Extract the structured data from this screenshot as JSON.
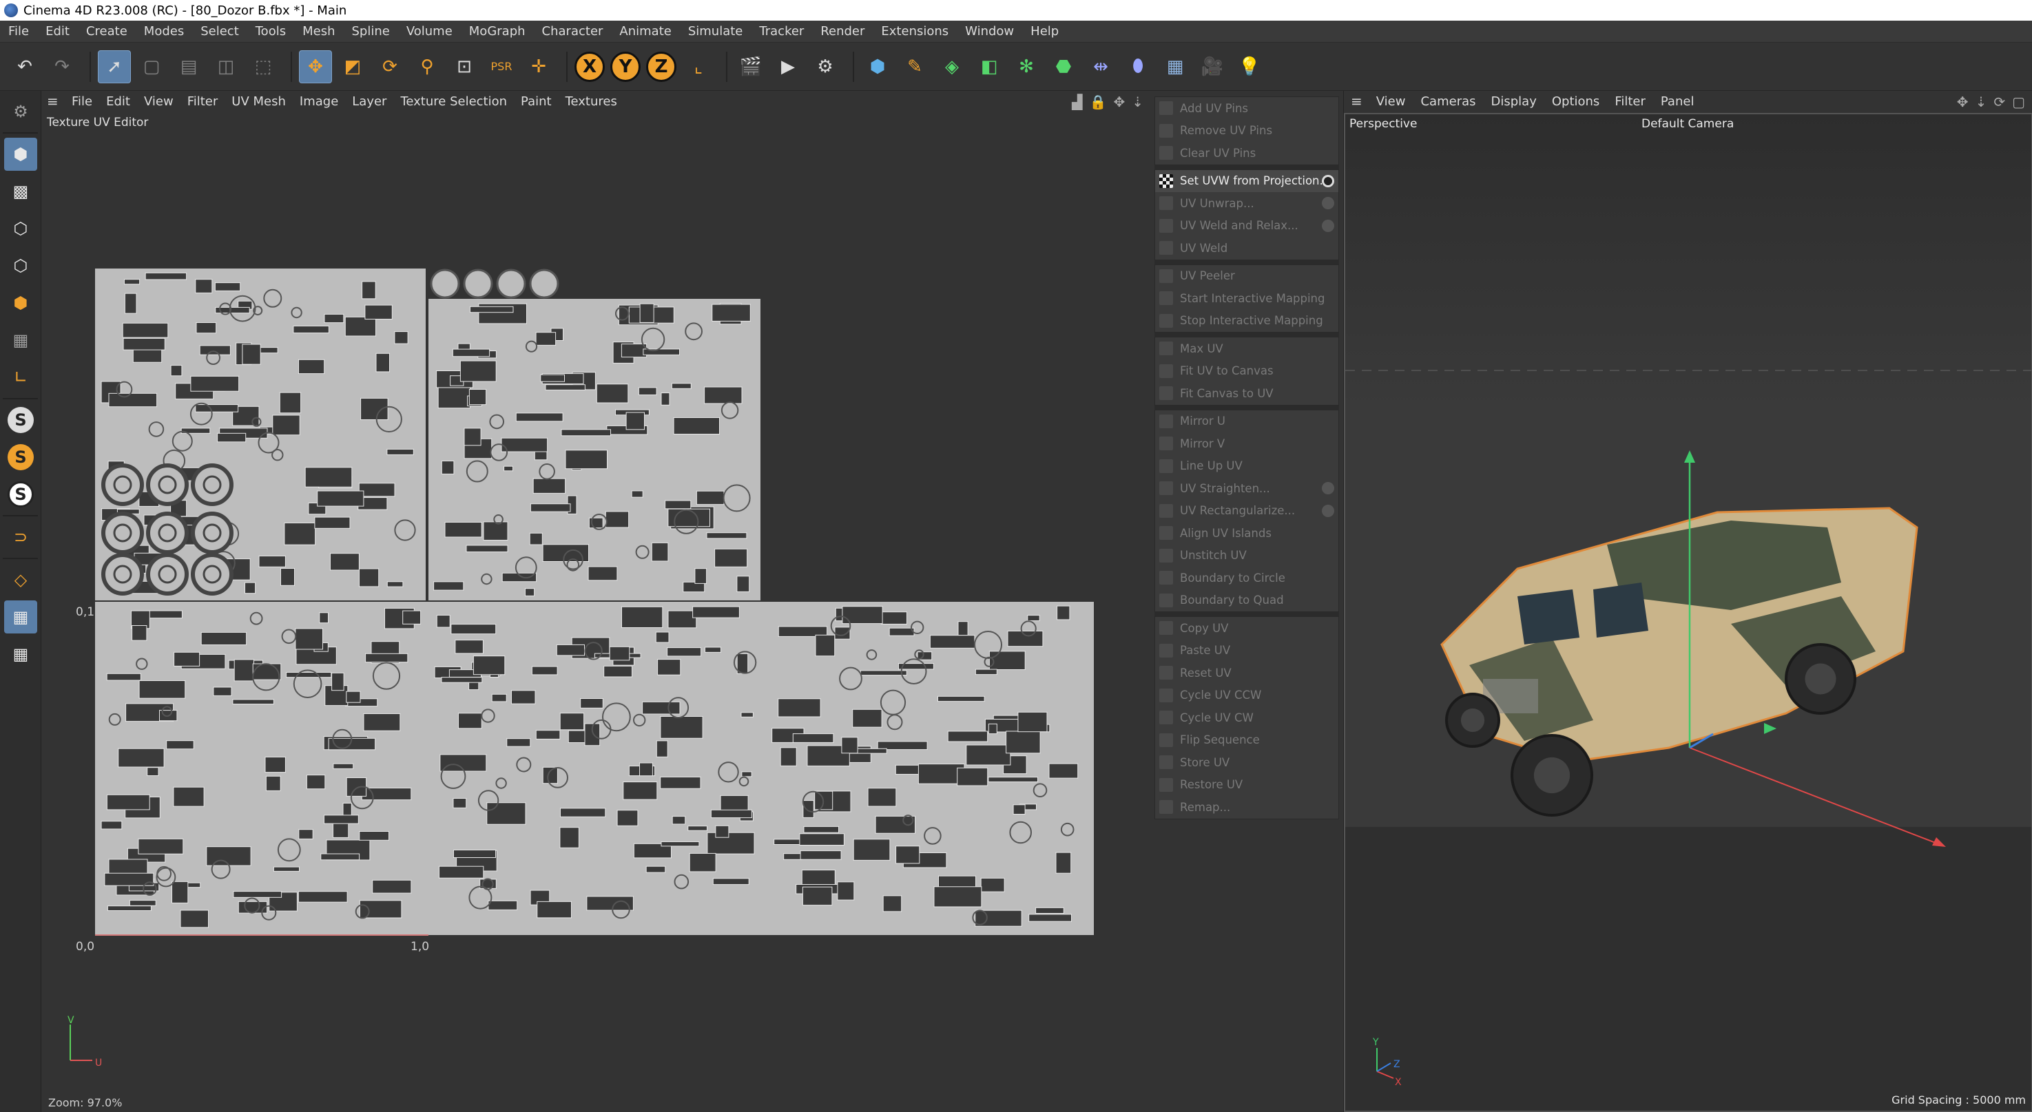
{
  "window": {
    "title": "Cinema 4D R23.008 (RC) - [80_Dozor B.fbx *] - Main"
  },
  "menubar": [
    "File",
    "Edit",
    "Create",
    "Modes",
    "Select",
    "Tools",
    "Mesh",
    "Spline",
    "Volume",
    "MoGraph",
    "Character",
    "Animate",
    "Simulate",
    "Tracker",
    "Render",
    "Extensions",
    "Window",
    "Help"
  ],
  "toolbar": {
    "axis_x": "X",
    "axis_y": "Y",
    "axis_z": "Z"
  },
  "uv_editor": {
    "menu": [
      "File",
      "Edit",
      "View",
      "Filter",
      "UV Mesh",
      "Image",
      "Layer",
      "Texture Selection",
      "Paint",
      "Textures"
    ],
    "title": "Texture UV Editor",
    "zoom": "Zoom: 97.0%",
    "label_origin": "0,0",
    "label_u1": "1,0",
    "label_v1": "0,1",
    "axis_v": "V",
    "axis_u": "U"
  },
  "commands": {
    "groups": [
      [
        "Add UV Pins",
        "Remove UV Pins",
        "Clear UV Pins"
      ],
      [
        "Set UVW from Projection...",
        "UV Unwrap...",
        "UV Weld and Relax...",
        "UV Weld"
      ],
      [
        "UV Peeler",
        "Start Interactive Mapping",
        "Stop Interactive Mapping"
      ],
      [
        "Max UV",
        "Fit UV to Canvas",
        "Fit Canvas to UV"
      ],
      [
        "Mirror U",
        "Mirror V",
        "Line Up UV",
        "UV Straighten...",
        "UV Rectangularize...",
        "Align UV Islands",
        "Unstitch UV",
        "Boundary to Circle",
        "Boundary to Quad"
      ],
      [
        "Copy UV",
        "Paste UV",
        "Reset UV",
        "Cycle UV CCW",
        "Cycle UV CW",
        "Flip Sequence",
        "Store UV",
        "Restore UV",
        "Remap..."
      ]
    ],
    "active": "Set UVW from Projection..."
  },
  "viewport": {
    "menu": [
      "View",
      "Cameras",
      "Display",
      "Options",
      "Filter",
      "Panel"
    ],
    "projection": "Perspective",
    "camera": "Default Camera",
    "grid_spacing": "Grid Spacing : 5000 mm",
    "axis_y": "Y",
    "axis_z": "Z",
    "axis_x": "X"
  },
  "colors": {
    "accent": "#5a7fa8",
    "axis_orange": "#f0a22e",
    "uv_island_fill": "#bdbdbd",
    "uv_hole": "#3a3a3a",
    "camo_light": "#c9b48a",
    "camo_dark": "#3d4a3a",
    "selection_outline": "#e08a3a"
  }
}
